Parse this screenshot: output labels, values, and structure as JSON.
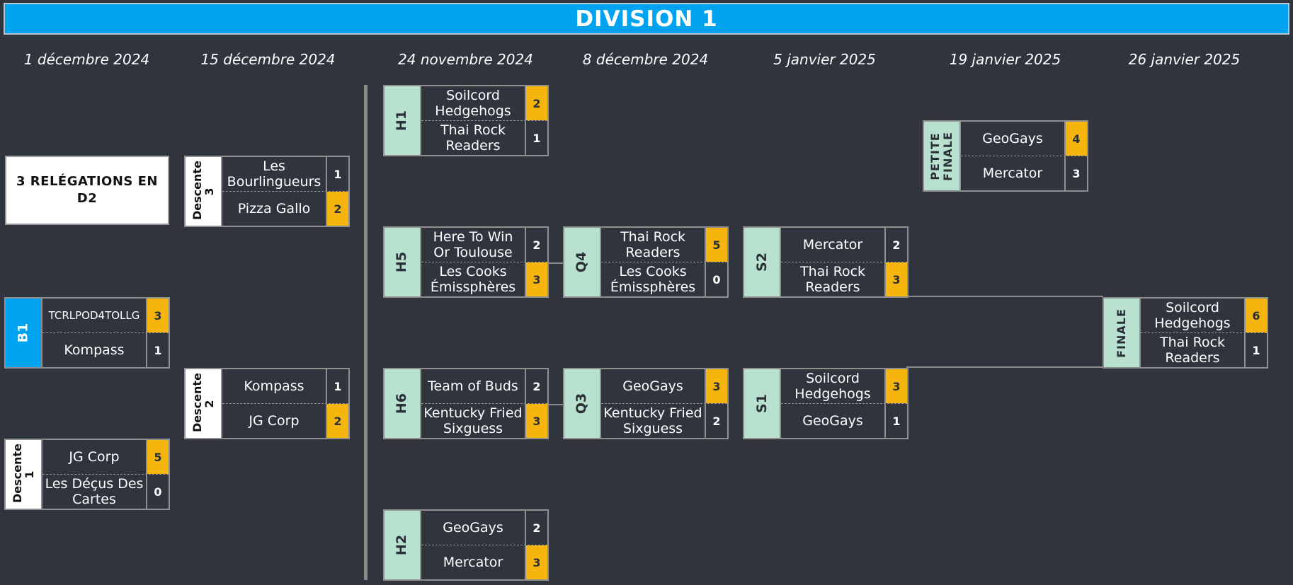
{
  "title": "DIVISION 1",
  "dates": [
    "1 décembre 2024",
    "15 décembre 2024",
    "24 novembre 2024",
    "8 décembre 2024",
    "5 janvier 2025",
    "19 janvier 2025",
    "26 janvier 2025"
  ],
  "relegation": "3 RELÉGATIONS EN D2",
  "colors": {
    "banner": "#00a3ef",
    "background": "#2f343d",
    "winner": "#f5b50d",
    "tag_mint": "#b8e2cf"
  },
  "matches": {
    "b1": {
      "tag": "B1",
      "t1": "TCRLPOD4TOLLG",
      "s1": "3",
      "t2": "Kompass",
      "s2": "1"
    },
    "desc1": {
      "tag": "Descente 1",
      "t1": "JG Corp",
      "s1": "5",
      "t2": "Les Déçus Des Cartes",
      "s2": "0"
    },
    "desc3": {
      "tag": "Descente 3",
      "t1": "Les Bourlingueurs",
      "s1": "1",
      "t2": "Pizza Gallo",
      "s2": "2"
    },
    "desc2": {
      "tag": "Descente 2",
      "t1": "Kompass",
      "s1": "1",
      "t2": "JG Corp",
      "s2": "2"
    },
    "h1": {
      "tag": "H1",
      "t1": "Soilcord Hedgehogs",
      "s1": "2",
      "t2": "Thai Rock Readers",
      "s2": "1"
    },
    "h5": {
      "tag": "H5",
      "t1": "Here To Win Or Toulouse",
      "s1": "2",
      "t2": "Les Cooks Émissphères",
      "s2": "3"
    },
    "h6": {
      "tag": "H6",
      "t1": "Team of Buds",
      "s1": "2",
      "t2": "Kentucky Fried Sixguess",
      "s2": "3"
    },
    "h2": {
      "tag": "H2",
      "t1": "GeoGays",
      "s1": "2",
      "t2": "Mercator",
      "s2": "3"
    },
    "q4": {
      "tag": "Q4",
      "t1": "Thai Rock Readers",
      "s1": "5",
      "t2": "Les Cooks Émissphères",
      "s2": "0"
    },
    "q3": {
      "tag": "Q3",
      "t1": "GeoGays",
      "s1": "3",
      "t2": "Kentucky Fried Sixguess",
      "s2": "2"
    },
    "s2": {
      "tag": "S2",
      "t1": "Mercator",
      "s1": "2",
      "t2": "Thai Rock Readers",
      "s2": "3"
    },
    "s1": {
      "tag": "S1",
      "t1": "Soilcord Hedgehogs",
      "s1": "3",
      "t2": "GeoGays",
      "s2": "1"
    },
    "petite": {
      "tag": "PETITE FINALE",
      "t1": "GeoGays",
      "s1": "4",
      "t2": "Mercator",
      "s2": "3"
    },
    "finale": {
      "tag": "FINALE",
      "t1": "Soilcord Hedgehogs",
      "s1": "6",
      "t2": "Thai Rock Readers",
      "s2": "1"
    }
  }
}
